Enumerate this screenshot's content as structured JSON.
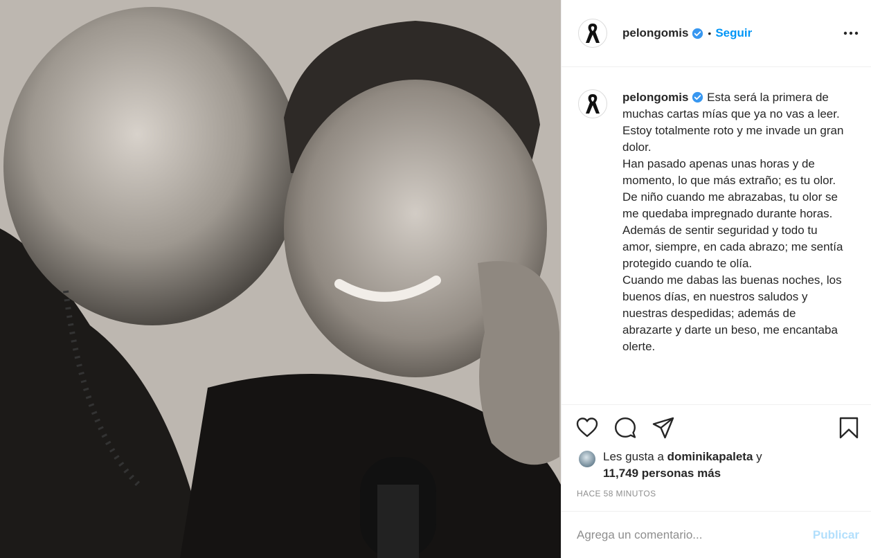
{
  "post": {
    "image_alt": "",
    "username": "pelongomis",
    "separator": "•",
    "follow_label": "Seguir"
  },
  "caption": {
    "username": "pelongomis",
    "text": "Esta será la primera de muchas cartas mías que ya no vas a leer.\nEstoy totalmente roto y me invade un gran dolor.\nHan pasado apenas unas horas y de momento, lo que más extraño; es tu olor.\nDe niño cuando me abrazabas, tu olor se me quedaba impregnado durante horas. Además de sentir seguridad y todo tu amor, siempre, en cada abrazo; me sentía protegido cuando te olía.\nCuando me dabas las buenas noches, los buenos días, en nuestros saludos y nuestras despedidas; además de abrazarte y darte un beso, me encantaba olerte."
  },
  "likes": {
    "prefix": "Les gusta a",
    "user": "dominikapaleta",
    "connector": "y",
    "count_text": "11,749 personas más"
  },
  "timestamp": "HACE 58 MINUTOS",
  "comment": {
    "placeholder": "Agrega un comentario...",
    "publish_label": "Publicar"
  },
  "colors": {
    "accent": "#0095f6",
    "publish_disabled": "#b2dffc",
    "muted": "#8e8e8e"
  },
  "icons": [
    "mourning-ribbon-icon",
    "verified-badge-icon",
    "more-options-icon",
    "heart-icon",
    "comment-icon",
    "share-icon",
    "bookmark-icon"
  ]
}
